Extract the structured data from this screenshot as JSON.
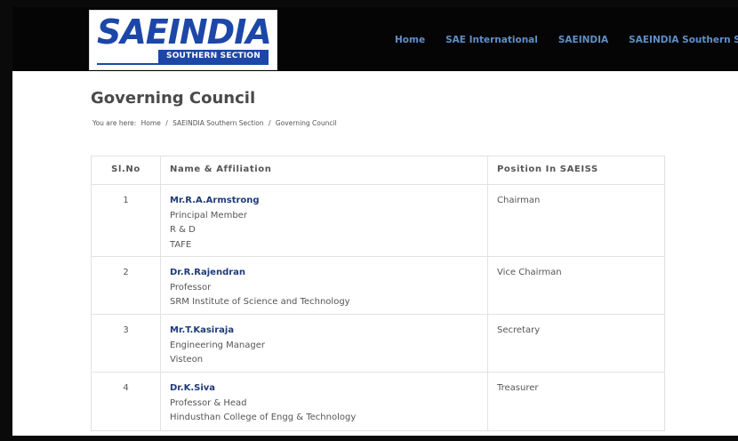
{
  "logo": {
    "word": "SAEINDIA",
    "subtitle": "SOUTHERN SECTION"
  },
  "nav": [
    {
      "label": "Home"
    },
    {
      "label": "SAE International"
    },
    {
      "label": "SAEINDIA"
    },
    {
      "label": "SAEINDIA Southern Secti"
    }
  ],
  "page": {
    "title": "Governing Council"
  },
  "breadcrumb": {
    "prefix": "You are here:",
    "items": [
      "Home",
      "/",
      "SAEINDIA Southern Section",
      "/",
      "Governing Council"
    ]
  },
  "table": {
    "headers": [
      "Sl.No",
      "Name & Affiliation",
      "Position In SAEISS"
    ],
    "rows": [
      {
        "slno": "1",
        "name": "Mr.R.A.Armstrong",
        "lines": [
          "Principal Member",
          "R & D",
          "TAFE"
        ],
        "position": "Chairman"
      },
      {
        "slno": "2",
        "name": "Dr.R.Rajendran",
        "lines": [
          "Professor",
          "SRM Institute of Science and Technology"
        ],
        "position": "Vice Chairman"
      },
      {
        "slno": "3",
        "name": "Mr.T.Kasiraja",
        "lines": [
          "Engineering Manager",
          "Visteon"
        ],
        "position": "Secretary"
      },
      {
        "slno": "4",
        "name": "Dr.K.Siva",
        "lines": [
          "Professor & Head",
          "Hindusthan College of Engg & Technology"
        ],
        "position": "Treasurer"
      }
    ]
  },
  "colors": {
    "brand": "#1c47a8",
    "nav_link": "#5f8fc9",
    "name_text": "#1e3a78"
  }
}
